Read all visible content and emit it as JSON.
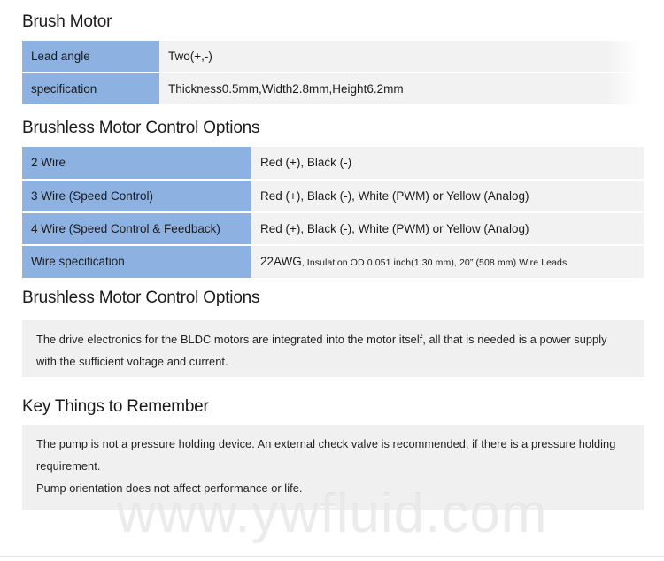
{
  "document": {
    "watermark": "www.ywfluid.com",
    "accent_blue": "#8db2e2",
    "cell_gray": "#f2f2f2",
    "panel_gray": "#f0f0f0"
  },
  "sections": {
    "brush_motor": {
      "heading": "Brush Motor",
      "rows": [
        {
          "key": "Lead angle",
          "value": "Two(+,-)"
        },
        {
          "key": "specification",
          "value": "Thickness0.5mm,Width2.8mm,Height6.2mm"
        }
      ]
    },
    "control_options_table": {
      "heading": "Brushless Motor Control Options",
      "rows": [
        {
          "key": "2 Wire",
          "value": "Red (+), Black (-)"
        },
        {
          "key": "3 Wire (Speed Control)",
          "value": "Red (+), Black (-), White (PWM) or Yellow (Analog)"
        },
        {
          "key": "4 Wire (Speed Control & Feedback)",
          "value": "Red (+), Black (-), White (PWM) or Yellow (Analog)"
        },
        {
          "key": "Wire specification",
          "value_lead": "22AWG",
          "value_rest": ", Insulation OD 0.051 inch(1.30 mm), 20” (508 mm) Wire Leads"
        }
      ]
    },
    "control_options_note": {
      "heading": "Brushless Motor Control Options",
      "paragraphs": [
        "The drive electronics for the BLDC motors are integrated into the motor itself, all that is needed is a power supply with the sufficient voltage and current."
      ]
    },
    "key_things": {
      "heading": "Key Things to Remember",
      "paragraphs": [
        "The pump is not a pressure holding device. An external check valve is recommended, if there is a pressure holding requirement.",
        "Pump orientation does not affect performance or life."
      ]
    }
  }
}
